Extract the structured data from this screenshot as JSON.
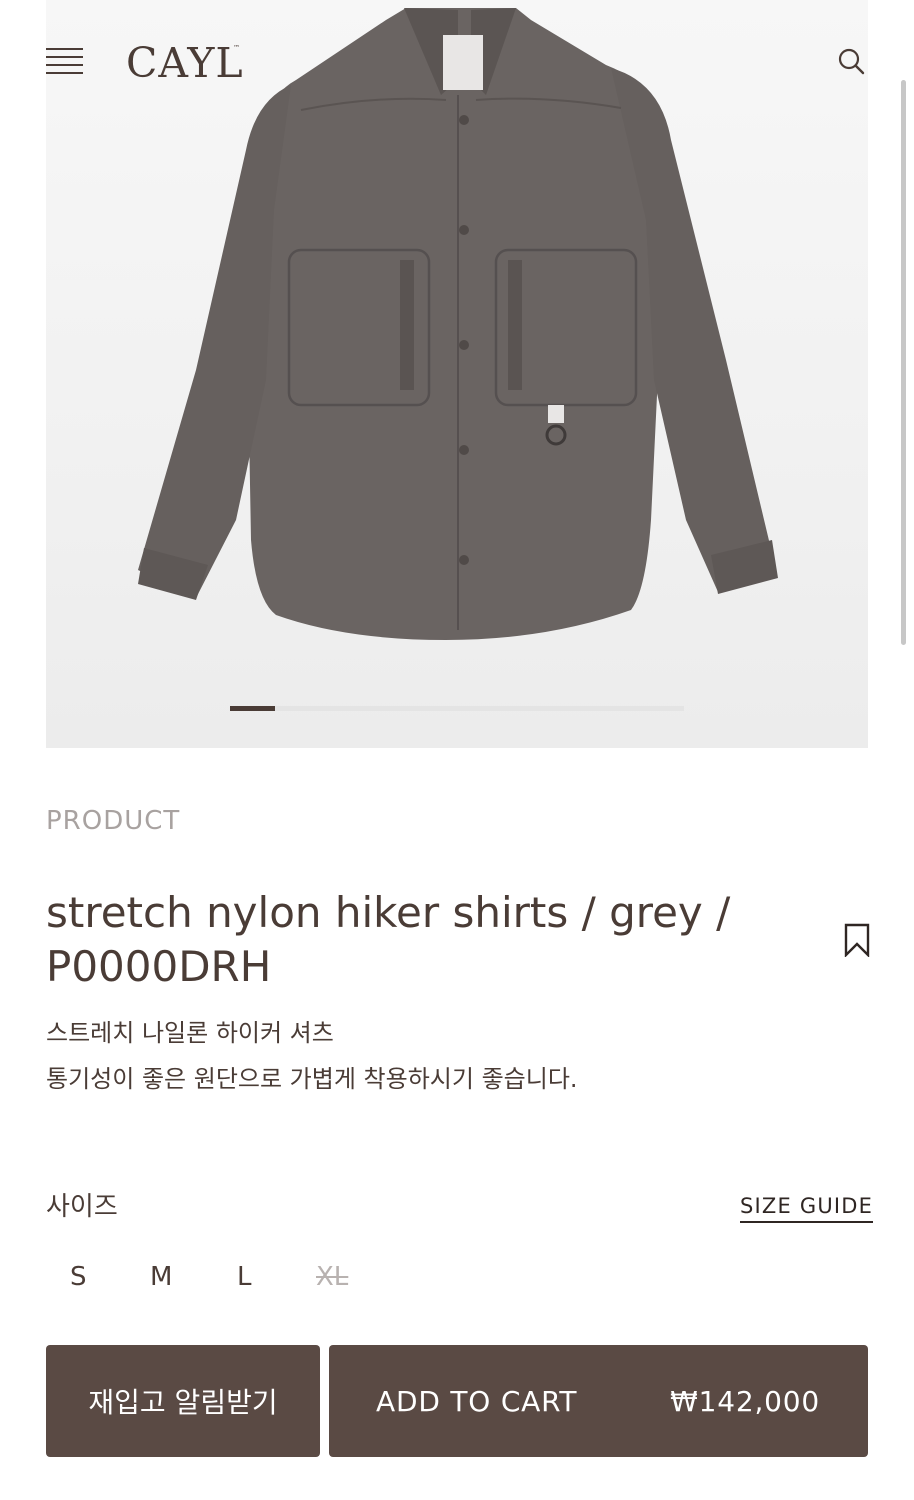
{
  "header": {
    "logo": "CAYL",
    "logo_tm": "™",
    "menu_icon": "hamburger-menu-icon",
    "search_icon": "search-icon"
  },
  "gallery": {
    "image": "grey-nylon-shirt-photo",
    "slide_progress": 0.1
  },
  "product": {
    "eyebrow": "PRODUCT",
    "title": "stretch nylon hiker shirts / grey / P0000DRH",
    "desc_line1": "스트레치 나일론 하이커 셔츠",
    "desc_line2": "통기성이 좋은 원단으로 가볍게 착용하시기 좋습니다.",
    "bookmark_icon": "bookmark-icon"
  },
  "size": {
    "label": "사이즈",
    "guide": "SIZE GUIDE",
    "options": [
      "S",
      "M",
      "L",
      "XL"
    ],
    "sold_out": [
      "XL"
    ]
  },
  "actions": {
    "restock": "재입고 알림받기",
    "add_to_cart": "ADD TO CART",
    "price": "₩142,000"
  },
  "colors": {
    "brand_brown": "#5a4a44",
    "text_brown": "#4a3c36",
    "muted": "#a8a2a0"
  }
}
